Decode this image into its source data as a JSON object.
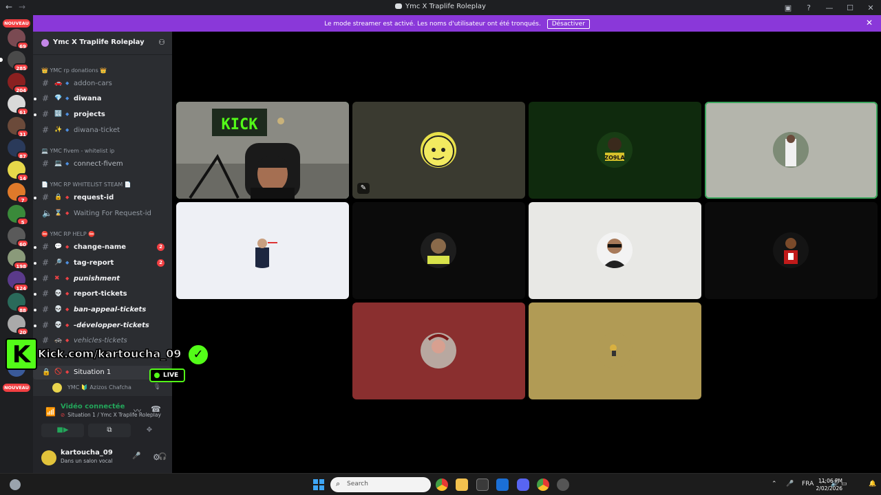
{
  "window": {
    "title": "Ymc X Traplife Roleplay"
  },
  "banner": {
    "message": "Le mode streamer est activé. Les noms d'utilisateur ont été tronqués.",
    "button": "Désactiver"
  },
  "rail": {
    "nouveau_top": "NOUVEAU",
    "nouveau_bottom": "NOUVEAU",
    "badges": [
      "69",
      "285",
      "204",
      "61",
      "31",
      "87",
      "14",
      "7",
      "5",
      "60",
      "198",
      "124",
      "88",
      "20"
    ]
  },
  "server": {
    "name": "Ymc X Traplife Roleplay"
  },
  "categories": [
    "👑 YMC rp donations 👑",
    "💻 YMC fivem - whitelist ip",
    "📄 YMC RP WHITELIST STEAM 📄",
    "⛔ YMC RP HELP ⛔"
  ],
  "channels": {
    "addon_cars": "addon-cars",
    "diwana": "diwana",
    "projects": "projects",
    "diwana_ticket": "diwana-ticket",
    "connect_fivem": "connect-fivem",
    "request_id": "request-id",
    "waiting_request": "Waiting For Request-id",
    "change_name": "change-name",
    "tag_report": "tag-report",
    "punishment": "punishment",
    "report_tickets": "report-tickets",
    "ban_appeal": "ban-appeal-tickets",
    "developper": "-développer-tickets",
    "vehicles": "vehicles-tickets",
    "situation": "Situation 1"
  },
  "channel_counts": {
    "change_name": "2",
    "tag_report": "2"
  },
  "voice_user": {
    "name": "YMC 🔰 Azizos Chafcha"
  },
  "voice_panel": {
    "status": "Vidéo connectée",
    "location": "Situation 1 / Ymc X Traplife Roleplay"
  },
  "user": {
    "name": "kartoucha_09",
    "status": "Dans un salon vocal"
  },
  "kick_overlay": {
    "url": "Kick.com/kartoucha_09",
    "live": "LIVE",
    "logo_letter": "K"
  },
  "taskbar": {
    "search_placeholder": "Search",
    "language": "FRA",
    "time": "11:06 PM",
    "date": "2/02/2026"
  },
  "colors": {
    "accent": "#8a38d9",
    "speaking": "#3ba55d",
    "kick_green": "#53fc18",
    "notify_red": "#f23f42"
  }
}
